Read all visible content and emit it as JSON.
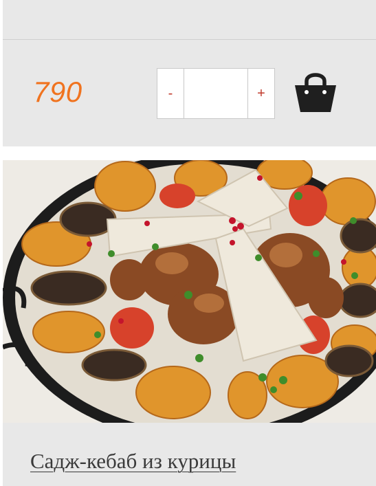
{
  "product_top": {
    "price": "790",
    "quantity": {
      "minus_label": "-",
      "plus_label": "+",
      "value": ""
    },
    "cart_icon": "shopping-basket-icon",
    "price_color": "#f0731f",
    "button_color": "#c0392b"
  },
  "product_bottom": {
    "image_alt": "Садж-кебаб из курицы",
    "title": "Садж-кебаб из курицы"
  }
}
